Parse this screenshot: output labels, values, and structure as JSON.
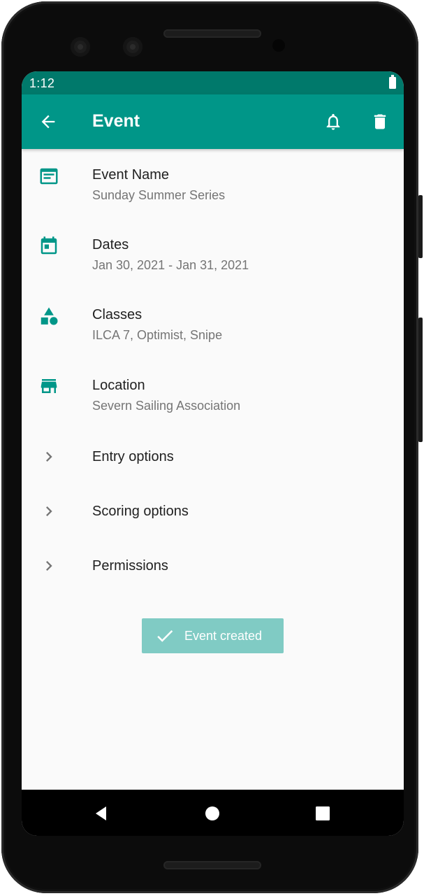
{
  "status_bar": {
    "time": "1:12"
  },
  "app_bar": {
    "title": "Event",
    "back_icon": "arrow-back-icon",
    "notification_icon": "bell-icon",
    "delete_icon": "trash-icon"
  },
  "items": [
    {
      "icon": "event-note-icon",
      "title": "Event Name",
      "subtitle": "Sunday Summer Series"
    },
    {
      "icon": "calendar-icon",
      "title": "Dates",
      "subtitle": "Jan 30, 2021 - Jan 31, 2021"
    },
    {
      "icon": "category-shapes-icon",
      "title": "Classes",
      "subtitle": "ILCA 7, Optimist, Snipe"
    },
    {
      "icon": "store-icon",
      "title": "Location",
      "subtitle": "Severn Sailing Association"
    }
  ],
  "sections": [
    {
      "icon": "chevron-right-icon",
      "title": "Entry options"
    },
    {
      "icon": "chevron-right-icon",
      "title": "Scoring options"
    },
    {
      "icon": "chevron-right-icon",
      "title": "Permissions"
    }
  ],
  "toast": {
    "icon": "check-icon",
    "label": "Event created"
  },
  "colors": {
    "status_bar": "#00796b",
    "primary": "#009688",
    "toast_bg": "#80cbc4",
    "background": "#fafafa"
  }
}
